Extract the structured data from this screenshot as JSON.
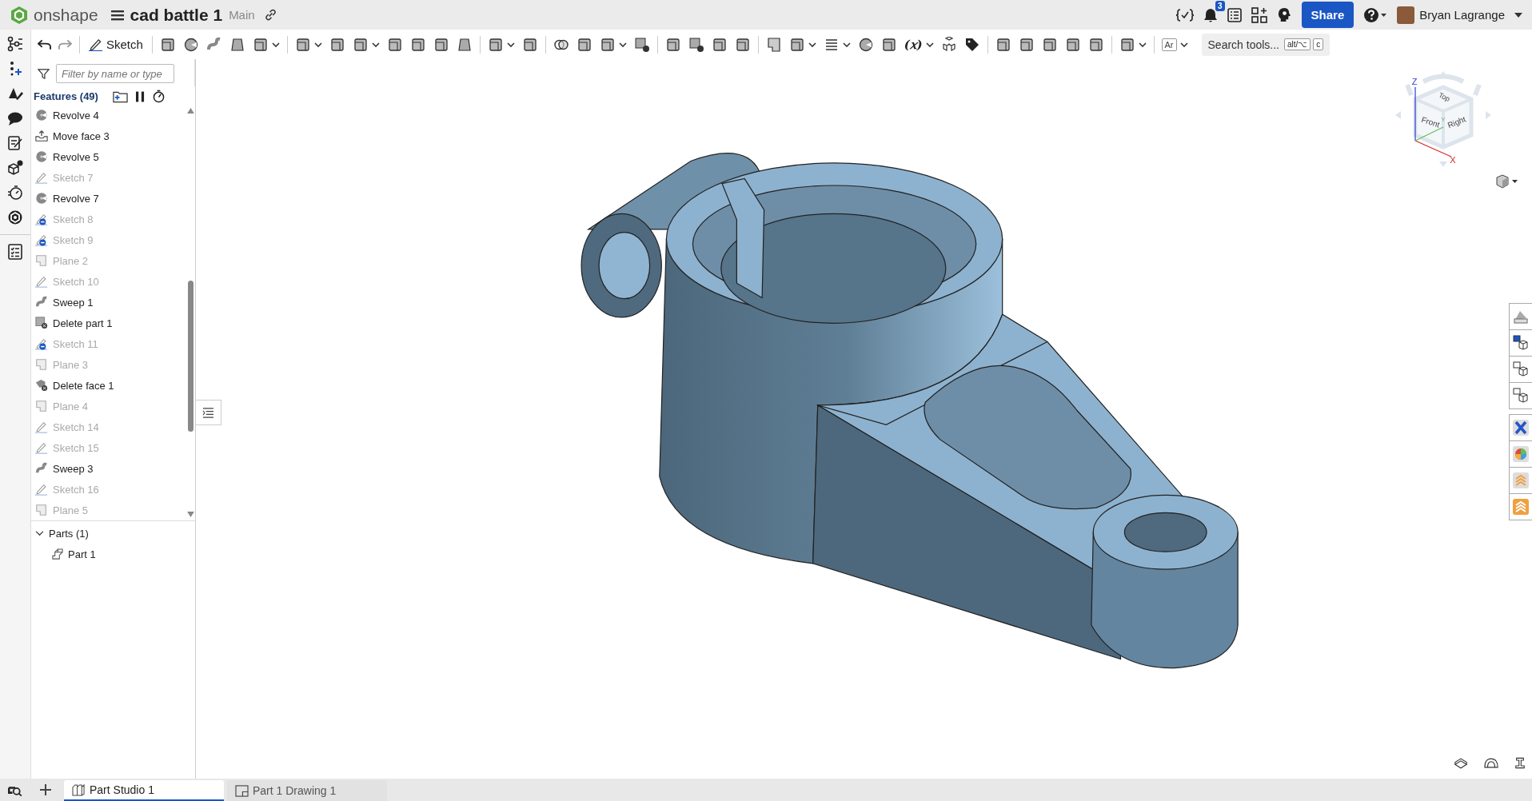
{
  "app": {
    "name": "onshape"
  },
  "document": {
    "title": "cad battle 1",
    "branch": "Main"
  },
  "header": {
    "notification_count": "3",
    "share_button": "Share",
    "user_name": "Bryan Lagrange"
  },
  "toolbar": {
    "sketch_button": "Sketch",
    "text_tool": "Ar",
    "variable_tool": "(𝑥)",
    "search": {
      "placeholder": "Search tools...",
      "shortcut_keys": [
        "alt/⌥",
        "c"
      ]
    }
  },
  "feature_panel": {
    "filter": {
      "placeholder": "Filter by name or type"
    },
    "title": "Features (49)",
    "features": [
      {
        "name": "Revolve 4",
        "kind": "revolve",
        "hidden": false,
        "excluded": false
      },
      {
        "name": "Move face 3",
        "kind": "move-face",
        "hidden": false,
        "excluded": false
      },
      {
        "name": "Revolve 5",
        "kind": "revolve",
        "hidden": false,
        "excluded": false
      },
      {
        "name": "Sketch 7",
        "kind": "sketch",
        "hidden": true,
        "excluded": false
      },
      {
        "name": "Revolve 7",
        "kind": "revolve",
        "hidden": false,
        "excluded": false
      },
      {
        "name": "Sketch 8",
        "kind": "sketch",
        "hidden": true,
        "excluded": true
      },
      {
        "name": "Sketch 9",
        "kind": "sketch",
        "hidden": true,
        "excluded": true
      },
      {
        "name": "Plane 2",
        "kind": "plane",
        "hidden": true,
        "excluded": false
      },
      {
        "name": "Sketch 10",
        "kind": "sketch",
        "hidden": true,
        "excluded": false
      },
      {
        "name": "Sweep 1",
        "kind": "sweep",
        "hidden": false,
        "excluded": false
      },
      {
        "name": "Delete part 1",
        "kind": "delete-part",
        "hidden": false,
        "excluded": false
      },
      {
        "name": "Sketch 11",
        "kind": "sketch",
        "hidden": true,
        "excluded": true
      },
      {
        "name": "Plane 3",
        "kind": "plane",
        "hidden": true,
        "excluded": false
      },
      {
        "name": "Delete face 1",
        "kind": "delete-face",
        "hidden": false,
        "excluded": false
      },
      {
        "name": "Plane 4",
        "kind": "plane",
        "hidden": true,
        "excluded": false
      },
      {
        "name": "Sketch 14",
        "kind": "sketch",
        "hidden": true,
        "excluded": false
      },
      {
        "name": "Sketch 15",
        "kind": "sketch",
        "hidden": true,
        "excluded": false
      },
      {
        "name": "Sweep 3",
        "kind": "sweep",
        "hidden": false,
        "excluded": false
      },
      {
        "name": "Sketch 16",
        "kind": "sketch",
        "hidden": true,
        "excluded": false
      },
      {
        "name": "Plane 5",
        "kind": "plane",
        "hidden": true,
        "excluded": false
      }
    ],
    "parts": {
      "title": "Parts (1)",
      "expanded": true,
      "items": [
        {
          "name": "Part 1"
        }
      ]
    }
  },
  "view_cube": {
    "faces": [
      "Top",
      "Front",
      "Right"
    ],
    "axes": [
      "X",
      "Y",
      "Z"
    ]
  },
  "tabs": [
    {
      "label": "Part Studio 1",
      "kind": "part-studio",
      "selected": true
    },
    {
      "label": "Part 1 Drawing 1",
      "kind": "drawing",
      "selected": false
    }
  ]
}
